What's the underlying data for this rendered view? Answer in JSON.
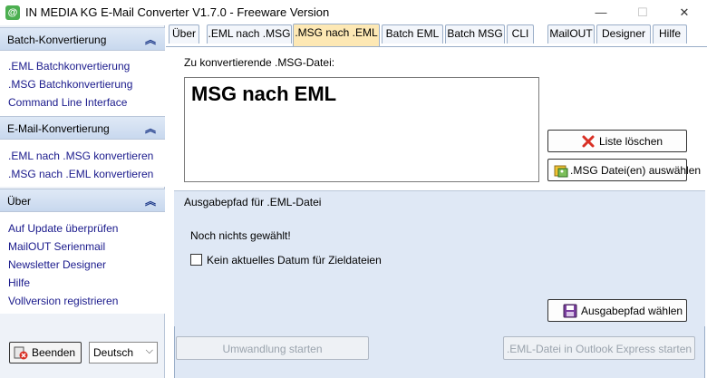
{
  "window": {
    "title": "IN MEDIA KG E-Mail Converter V1.7.0 - Freeware Version",
    "app_icon_glyph": "@",
    "minimize_glyph": "—",
    "maximize_glyph": "☐",
    "close_glyph": "✕"
  },
  "sidebar": {
    "groups": [
      {
        "label": "Batch-Konvertierung",
        "chevron": "︽",
        "items": [
          ".EML Batchkonvertierung",
          ".MSG Batchkonvertierung",
          "Command Line Interface"
        ]
      },
      {
        "label": "E-Mail-Konvertierung",
        "chevron": "︽",
        "items": [
          ".EML nach .MSG konvertieren",
          ".MSG nach .EML konvertieren"
        ]
      },
      {
        "label": "Über",
        "chevron": "︽",
        "items": [
          "Auf Update überprüfen",
          "MailOUT Serienmail",
          "Newsletter Designer",
          "Hilfe",
          "Vollversion registrieren"
        ]
      }
    ],
    "quit_button": "Beenden",
    "language": {
      "selected": "Deutsch",
      "chevron": "⌵"
    }
  },
  "tabs": [
    {
      "label": "Über",
      "active": false
    },
    {
      "label": ".EML nach .MSG",
      "active": false
    },
    {
      "label": ".MSG nach .EML",
      "active": true
    },
    {
      "label": "Batch EML",
      "active": false
    },
    {
      "label": "Batch MSG",
      "active": false
    },
    {
      "label": "CLI",
      "active": false
    },
    {
      "label": "MailOUT",
      "active": false
    },
    {
      "label": "Designer",
      "active": false
    },
    {
      "label": "Hilfe",
      "active": false
    }
  ],
  "main": {
    "source_label": "Zu konvertierende  .MSG-Datei:",
    "list_content": "MSG nach EML",
    "clear_button": "Liste löschen",
    "select_button": ".MSG Datei(en) auswählen",
    "output_group_label": "Ausgabepfad für .EML-Datei",
    "output_status": "Noch nichts gewählt!",
    "no_date_checkbox": {
      "label": "Kein aktuelles Datum für Zieldateien",
      "checked": false
    },
    "choose_path_button": "Ausgabepfad wählen",
    "start_button": "Umwandlung starten",
    "outlook_button": ".EML-Datei in Outlook Express starten"
  }
}
